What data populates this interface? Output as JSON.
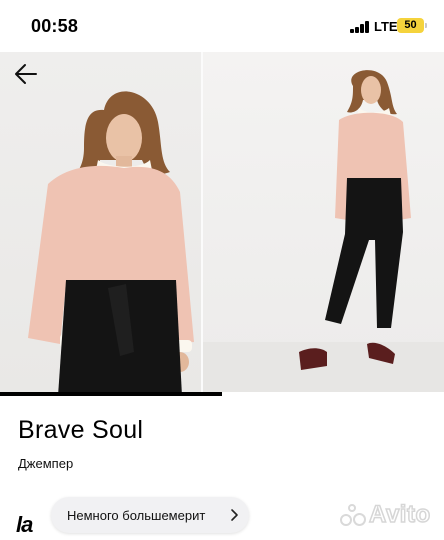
{
  "status_bar": {
    "time": "00:58",
    "network": "LTE",
    "battery_level": "50"
  },
  "gallery": {
    "photo_count_visible": 2,
    "progress_fraction": 0.5,
    "accent_color": "#000000"
  },
  "listing": {
    "title": "Brave Soul",
    "category": "Джемпер"
  },
  "bottom": {
    "brand_logo": "la",
    "chip_label": "Немного большемерит",
    "watermark": "Avito"
  },
  "icons": {
    "back": "arrow-left-icon",
    "chip_arrow": "chevron-right-icon",
    "signal": "signal-bars-icon",
    "battery": "battery-icon"
  }
}
